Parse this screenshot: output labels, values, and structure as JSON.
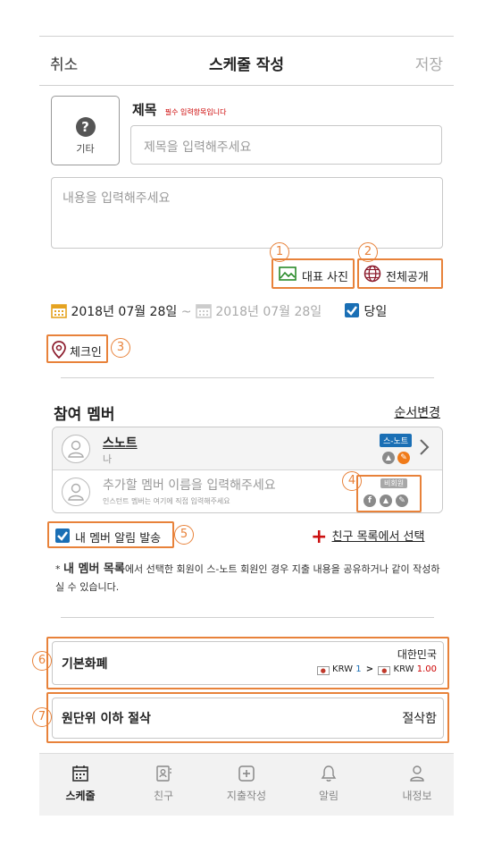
{
  "header": {
    "cancel": "취소",
    "title": "스케줄 작성",
    "save": "저장"
  },
  "category": {
    "label": "기타",
    "icon": "question-icon"
  },
  "title_field": {
    "label": "제목",
    "required": "필수 입력항목입니다",
    "placeholder": "제목을 입력해주세요"
  },
  "content_field": {
    "placeholder": "내용을 입력해주세요"
  },
  "actions": {
    "photo": "대표 사진",
    "visibility": "전체공개"
  },
  "dates": {
    "start": "2018년 07월 28일",
    "separator": "~",
    "end": "2018년 07월 28일",
    "same_day": "당일"
  },
  "checkin": {
    "label": "체크인"
  },
  "members": {
    "heading": "참여 멤버",
    "reorder": "순서변경",
    "list": [
      {
        "name": "스노트",
        "sub": "나",
        "badge": "스-노트"
      },
      {
        "name": "추가할 멤버 이름을 입력해주세요",
        "sub": "인스턴트 멤버는 여기에 직접 입력해주세요",
        "badge": "비회원"
      }
    ],
    "notify": "내 멤버 알림 발송",
    "friend_select": "친구 목록에서 선택",
    "note_bold": "내 멤버 목록",
    "note": "* 내 멤버 목록에서 선택한 회원이 스-노트 회원인 경우 지출 내용을 공유하거나 같이 작성하실 수 있습니다."
  },
  "currency": {
    "label": "기본화폐",
    "country": "대한민국",
    "from_code": "KRW",
    "from_value": "1",
    "to_code": "KRW",
    "to_value": "1.00"
  },
  "rounding": {
    "label": "원단위 이하 절삭",
    "value": "절삭함"
  },
  "annotations": [
    "1",
    "2",
    "3",
    "4",
    "5",
    "6",
    "7"
  ],
  "tabs": [
    {
      "label": "스케줄",
      "icon": "calendar-icon"
    },
    {
      "label": "친구",
      "icon": "contact-icon"
    },
    {
      "label": "지출작성",
      "icon": "plus-square-icon"
    },
    {
      "label": "알림",
      "icon": "bell-icon"
    },
    {
      "label": "내정보",
      "icon": "person-icon"
    }
  ],
  "colors": {
    "accent": "#e8823a",
    "brand_blue": "#1a6fb5",
    "required_red": "#cc0000",
    "date_gold": "#e5a321",
    "red_plus": "#cc1111",
    "pin": "#8b1a2b"
  }
}
